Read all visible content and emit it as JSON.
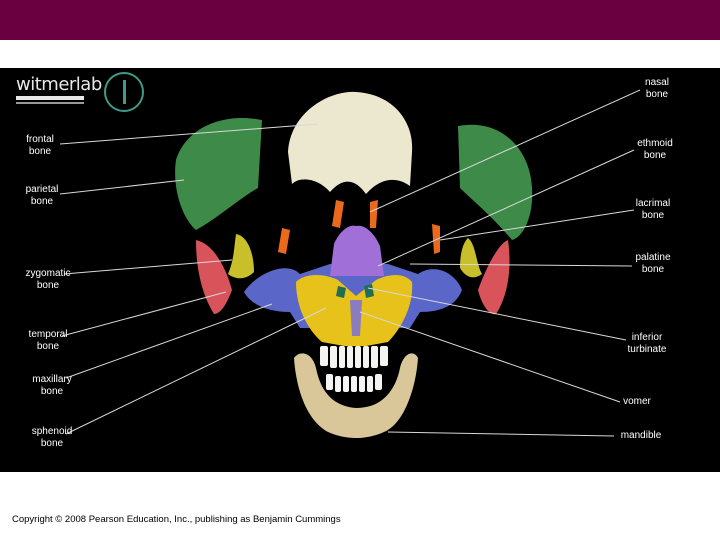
{
  "colors": {
    "header_bar": "#6b0040",
    "background": "#000000",
    "frontal": "#ece7cf",
    "parietal": "#3e8a48",
    "zygomatic": "#c9bf2a",
    "temporal": "#d8545a",
    "maxillary": "#e6c21a",
    "sphenoid": "#5a66c8",
    "ethmoid": "#a070d8",
    "lacrimal": "#e96a1c",
    "vomer": "#8b7cc0",
    "mandible": "#d9c79a",
    "teeth": "#f4f4f0",
    "inferior_turbinate": "#1f6e55"
  },
  "logo": {
    "text": "witmerlab"
  },
  "labels_left": [
    {
      "id": "frontal",
      "text": "frontal\nbone"
    },
    {
      "id": "parietal",
      "text": "parietal\nbone"
    },
    {
      "id": "zygomatic",
      "text": "zygomatic\nbone"
    },
    {
      "id": "temporal",
      "text": "temporal\nbone"
    },
    {
      "id": "maxillary",
      "text": "maxillary\nbone"
    },
    {
      "id": "sphenoid",
      "text": "sphenoid\nbone"
    }
  ],
  "labels_right": [
    {
      "id": "nasal",
      "text": "nasal\nbone"
    },
    {
      "id": "ethmoid",
      "text": "ethmoid\nbone"
    },
    {
      "id": "lacrimal",
      "text": "lacrimal\nbone"
    },
    {
      "id": "palatine",
      "text": "palatine\nbone"
    },
    {
      "id": "inferior_turbinate",
      "text": "inferior\nturbinate"
    },
    {
      "id": "vomer",
      "text": "vomer"
    },
    {
      "id": "mandible",
      "text": "mandible"
    }
  ],
  "footer": {
    "copyright": "Copyright © 2008 Pearson Education, Inc., publishing as Benjamin Cummings"
  }
}
